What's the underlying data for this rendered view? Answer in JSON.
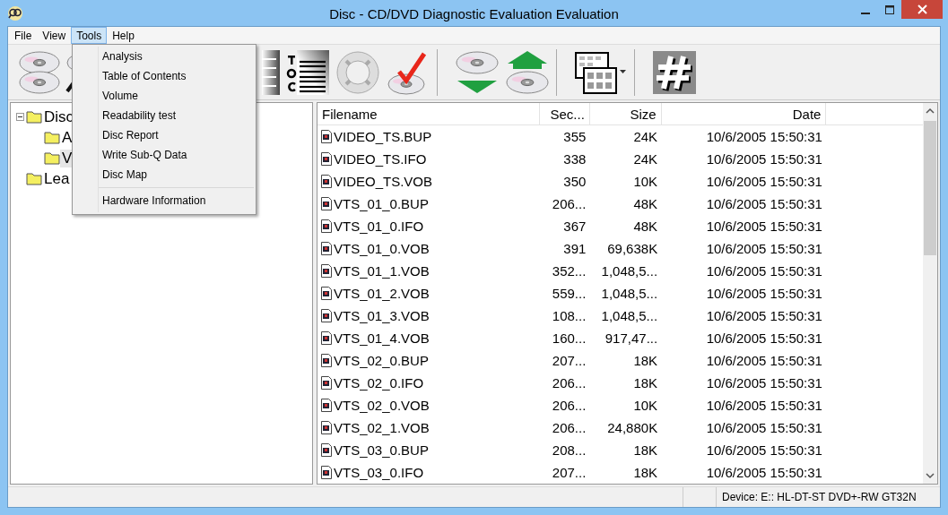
{
  "window": {
    "title": "Disc - CD/DVD Diagnostic Evaluation Evaluation"
  },
  "menu": [
    {
      "label": "File",
      "selected": false
    },
    {
      "label": "View",
      "selected": false
    },
    {
      "label": "Tools",
      "selected": true
    },
    {
      "label": "Help",
      "selected": false
    }
  ],
  "tools_menu": [
    {
      "kind": "item",
      "label": "Analysis"
    },
    {
      "kind": "item",
      "label": "Table of Contents"
    },
    {
      "kind": "item",
      "label": "Volume"
    },
    {
      "kind": "item",
      "label": "Readability test"
    },
    {
      "kind": "item",
      "label": "Disc Report"
    },
    {
      "kind": "item",
      "label": "Write Sub-Q Data"
    },
    {
      "kind": "item",
      "label": "Disc Map"
    },
    {
      "kind": "separator"
    },
    {
      "kind": "item",
      "label": "Hardware Information"
    }
  ],
  "tree": [
    {
      "label": "Disc",
      "expanded": true,
      "selected": false,
      "children": [
        {
          "label": "A",
          "selected": false
        },
        {
          "label": "V",
          "selected": true
        }
      ]
    },
    {
      "label": "Lea",
      "selected": false
    }
  ],
  "file_list": {
    "columns": [
      "Filename",
      "Sec...",
      "Size",
      "Date"
    ],
    "rows": [
      [
        "VIDEO_TS.BUP",
        "355",
        "24K",
        "10/6/2005 15:50:31"
      ],
      [
        "VIDEO_TS.IFO",
        "338",
        "24K",
        "10/6/2005 15:50:31"
      ],
      [
        "VIDEO_TS.VOB",
        "350",
        "10K",
        "10/6/2005 15:50:31"
      ],
      [
        "VTS_01_0.BUP",
        "206...",
        "48K",
        "10/6/2005 15:50:31"
      ],
      [
        "VTS_01_0.IFO",
        "367",
        "48K",
        "10/6/2005 15:50:31"
      ],
      [
        "VTS_01_0.VOB",
        "391",
        "69,638K",
        "10/6/2005 15:50:31"
      ],
      [
        "VTS_01_1.VOB",
        "352...",
        "1,048,5...",
        "10/6/2005 15:50:31"
      ],
      [
        "VTS_01_2.VOB",
        "559...",
        "1,048,5...",
        "10/6/2005 15:50:31"
      ],
      [
        "VTS_01_3.VOB",
        "108...",
        "1,048,5...",
        "10/6/2005 15:50:31"
      ],
      [
        "VTS_01_4.VOB",
        "160...",
        "917,47...",
        "10/6/2005 15:50:31"
      ],
      [
        "VTS_02_0.BUP",
        "207...",
        "18K",
        "10/6/2005 15:50:31"
      ],
      [
        "VTS_02_0.IFO",
        "206...",
        "18K",
        "10/6/2005 15:50:31"
      ],
      [
        "VTS_02_0.VOB",
        "206...",
        "10K",
        "10/6/2005 15:50:31"
      ],
      [
        "VTS_02_1.VOB",
        "206...",
        "24,880K",
        "10/6/2005 15:50:31"
      ],
      [
        "VTS_03_0.BUP",
        "208...",
        "18K",
        "10/6/2005 15:50:31"
      ],
      [
        "VTS_03_0.IFO",
        "207...",
        "18K",
        "10/6/2005 15:50:31"
      ]
    ]
  },
  "status_bar": {
    "device": "Device: E:: HL-DT-ST DVD+-RW GT32N"
  }
}
